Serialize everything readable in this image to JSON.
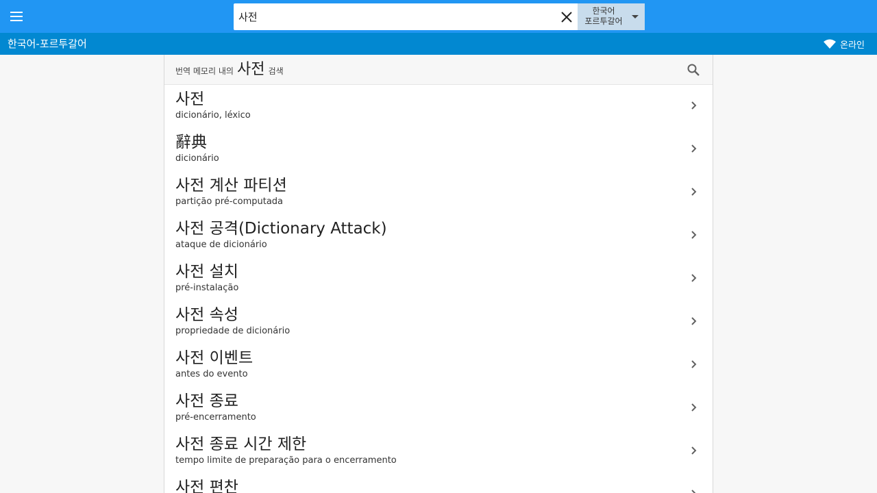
{
  "header": {
    "menu_icon": "menu-icon",
    "search": {
      "value": "사전",
      "placeholder": ""
    },
    "clear_icon": "close-icon",
    "language": {
      "line1": "한국어",
      "line2": "포르투갈어",
      "caret_icon": "caret-down-icon"
    }
  },
  "subheader": {
    "pair_title": "한국어-포르투갈어",
    "status": {
      "icon": "wifi-icon",
      "label": "온라인"
    }
  },
  "translation_memory": {
    "prefix": "번역 메모리 내의",
    "term": "사전",
    "suffix": "검색",
    "icon": "search-icon"
  },
  "entries": [
    {
      "term": "사전",
      "translation": "dicionário, léxico"
    },
    {
      "term": "辭典",
      "translation": "dicionário"
    },
    {
      "term": "사전 계산 파티션",
      "translation": "partição pré-computada"
    },
    {
      "term": "사전 공격(Dictionary Attack)",
      "translation": "ataque de dicionário"
    },
    {
      "term": "사전 설치",
      "translation": "pré-instalação"
    },
    {
      "term": "사전 속성",
      "translation": "propriedade de dicionário"
    },
    {
      "term": "사전 이벤트",
      "translation": "antes do evento"
    },
    {
      "term": "사전 종료",
      "translation": "pré-encerramento"
    },
    {
      "term": "사전 종료 시간 제한",
      "translation": "tempo limite de preparação para o encerramento"
    },
    {
      "term": "사전 편찬",
      "translation": ""
    }
  ],
  "colors": {
    "topbar": "#2196f3",
    "subbar": "#0288d1",
    "language_select": "#c8dcec"
  }
}
